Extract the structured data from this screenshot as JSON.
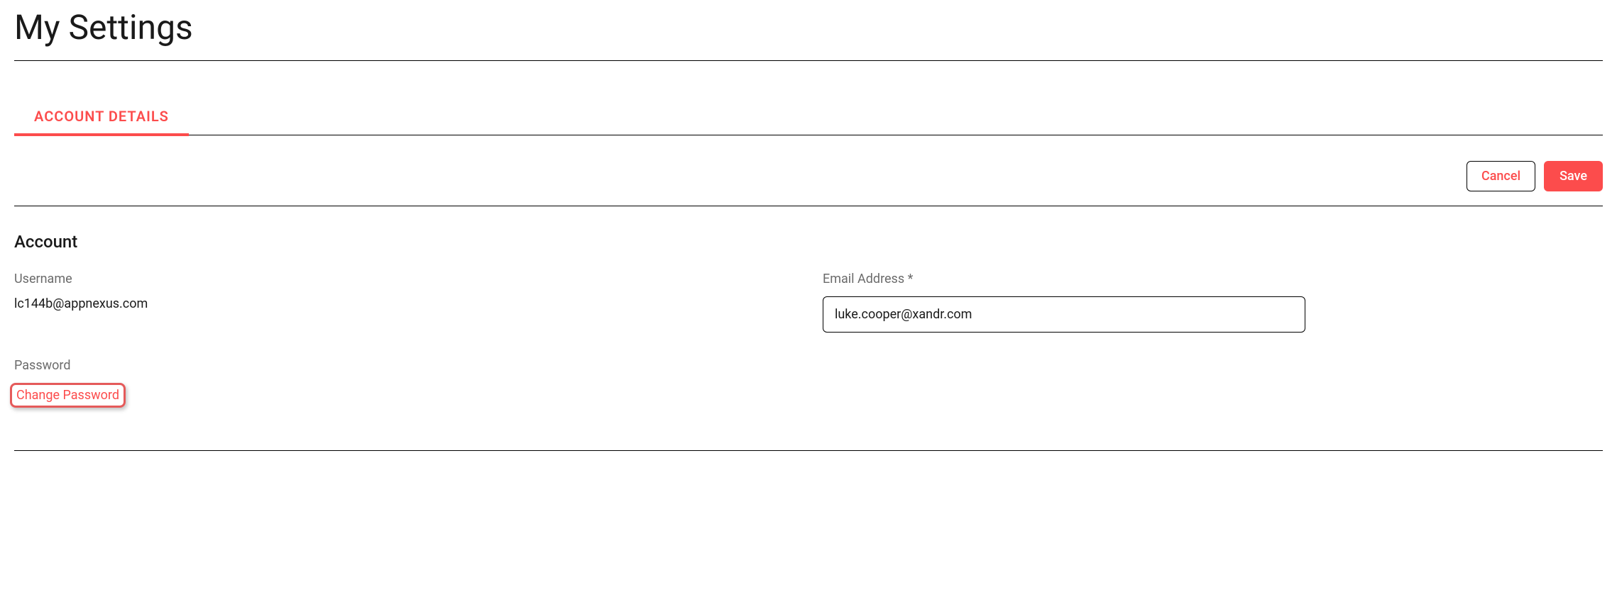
{
  "page": {
    "title": "My Settings"
  },
  "tabs": {
    "active": "ACCOUNT DETAILS"
  },
  "actions": {
    "cancel": "Cancel",
    "save": "Save"
  },
  "account": {
    "section_title": "Account",
    "username_label": "Username",
    "username_value": "lc144b@appnexus.com",
    "email_label": "Email Address *",
    "email_value": "luke.cooper@xandr.com",
    "password_label": "Password",
    "change_password": "Change Password"
  }
}
